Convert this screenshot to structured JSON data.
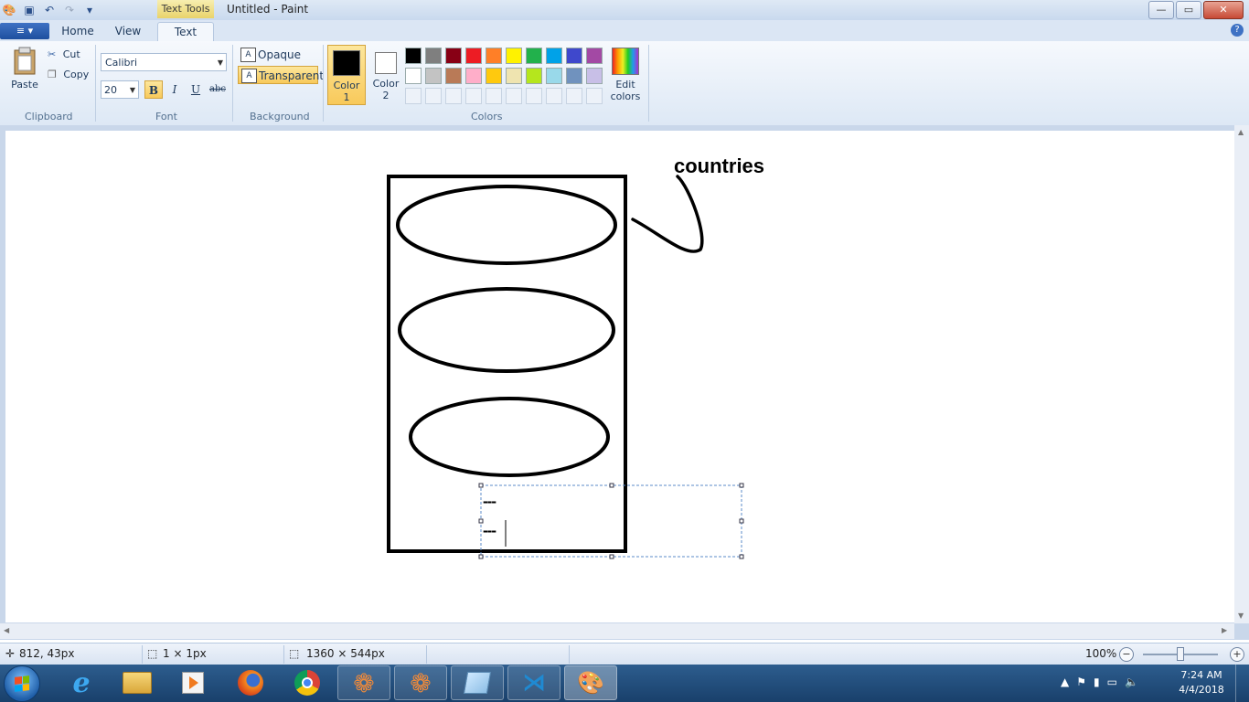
{
  "window": {
    "title": "Untitled - Paint",
    "contextual_tab": "Text Tools",
    "controls": {
      "minimize": "—",
      "maximize": "▭",
      "close": "✕"
    }
  },
  "quick_access": {
    "save_icon": "save-icon",
    "undo_icon": "undo-icon",
    "redo_icon": "redo-icon",
    "customize_icon": "chevron-down-icon"
  },
  "tabs": {
    "file_menu": "≡ ▾",
    "items": [
      "Home",
      "View",
      "Text"
    ],
    "active": "Text",
    "help": "?"
  },
  "ribbon": {
    "clipboard": {
      "paste": "Paste",
      "cut": "Cut",
      "copy": "Copy",
      "group": "Clipboard"
    },
    "font": {
      "family": "Calibri",
      "size": "20",
      "bold": "B",
      "italic": "I",
      "underline": "U",
      "strikethrough": "abc",
      "group": "Font",
      "bold_active": true
    },
    "background": {
      "opaque": "Opaque",
      "transparent": "Transparent",
      "selected": "Transparent",
      "group": "Background"
    },
    "colors": {
      "color1_label": "Color 1",
      "color1_line1": "Color",
      "color1_line2": "1",
      "color2_line1": "Color",
      "color2_line2": "2",
      "color1": "#000000",
      "color2": "#ffffff",
      "palette": [
        "#000000",
        "#7f7f7f",
        "#880015",
        "#ed1c24",
        "#ff7f27",
        "#fff200",
        "#22b14c",
        "#00a2e8",
        "#3f48cc",
        "#a349a4",
        "#ffffff",
        "#c3c3c3",
        "#b97a57",
        "#ffaec9",
        "#ffc90e",
        "#efe4b0",
        "#b5e61d",
        "#99d9ea",
        "#7092be",
        "#c8bfe7"
      ],
      "empty_slots": 10,
      "edit_line1": "Edit",
      "edit_line2": "colors",
      "group": "Colors"
    }
  },
  "canvas": {
    "annotation_text": "countries",
    "textbox_line1": "---",
    "textbox_line2": "---"
  },
  "status": {
    "cursor_pos": "812, 43px",
    "selection_size": "1 × 1px",
    "image_size": "1360 × 544px",
    "zoom": "100%"
  },
  "taskbar": {
    "apps": [
      "internet-explorer",
      "file-explorer",
      "media-player",
      "firefox",
      "chrome",
      "app-flower-1",
      "app-flower-2",
      "notepad",
      "vscode",
      "paint"
    ],
    "clock_time": "7:24 AM",
    "clock_date": "4/4/2018"
  }
}
